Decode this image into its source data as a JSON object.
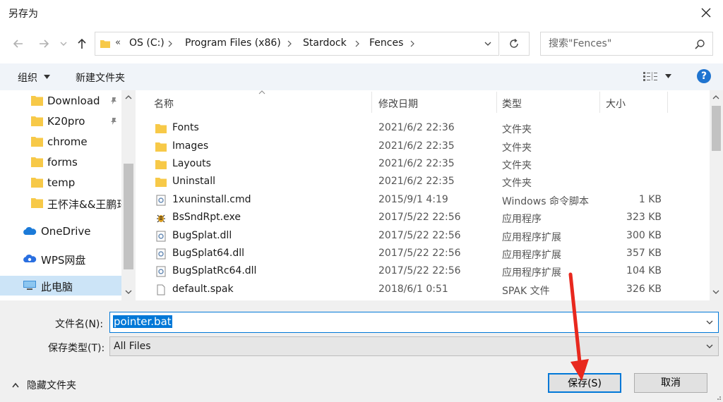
{
  "window": {
    "title": "另存为"
  },
  "address": {
    "crumbs": [
      "OS (C:)",
      "Program Files (x86)",
      "Stardock",
      "Fences"
    ],
    "overflow": "«"
  },
  "search": {
    "placeholder": "搜索\"Fences\""
  },
  "toolbar": {
    "organize": "组织",
    "new_folder": "新建文件夹",
    "help": "?"
  },
  "sidebar": {
    "items": [
      {
        "label": "Download",
        "icon": "folder-icon",
        "pinned": true
      },
      {
        "label": "K20pro",
        "icon": "folder-icon",
        "pinned": true
      },
      {
        "label": "chrome",
        "icon": "folder-icon",
        "pinned": false
      },
      {
        "label": "forms",
        "icon": "folder-icon",
        "pinned": false
      },
      {
        "label": "temp",
        "icon": "folder-icon",
        "pinned": false
      },
      {
        "label": "王怀沣&&王鹏玮",
        "icon": "folder-icon",
        "pinned": false
      },
      {
        "label": "OneDrive",
        "icon": "onedrive-icon",
        "pinned": false
      },
      {
        "label": "WPS网盘",
        "icon": "wps-cloud-icon",
        "pinned": false
      },
      {
        "label": "此电脑",
        "icon": "this-pc-icon",
        "pinned": false,
        "selected": true
      }
    ]
  },
  "columns": {
    "name": "名称",
    "date": "修改日期",
    "type": "类型",
    "size": "大小"
  },
  "files": [
    {
      "name": "Fonts",
      "date": "2021/6/2 22:36",
      "type": "文件夹",
      "size": "",
      "icon": "folder-icon"
    },
    {
      "name": "Images",
      "date": "2021/6/2 22:35",
      "type": "文件夹",
      "size": "",
      "icon": "folder-icon"
    },
    {
      "name": "Layouts",
      "date": "2021/6/2 22:35",
      "type": "文件夹",
      "size": "",
      "icon": "folder-icon"
    },
    {
      "name": "Uninstall",
      "date": "2021/6/2 22:35",
      "type": "文件夹",
      "size": "",
      "icon": "folder-icon"
    },
    {
      "name": "1xuninstall.cmd",
      "date": "2015/9/1 4:19",
      "type": "Windows 命令脚本",
      "size": "1 KB",
      "icon": "cmd-file-icon"
    },
    {
      "name": "BsSndRpt.exe",
      "date": "2017/5/22 22:56",
      "type": "应用程序",
      "size": "323 KB",
      "icon": "bug-exe-icon"
    },
    {
      "name": "BugSplat.dll",
      "date": "2017/5/22 22:56",
      "type": "应用程序扩展",
      "size": "300 KB",
      "icon": "dll-file-icon"
    },
    {
      "name": "BugSplat64.dll",
      "date": "2017/5/22 22:56",
      "type": "应用程序扩展",
      "size": "357 KB",
      "icon": "dll-file-icon"
    },
    {
      "name": "BugSplatRc64.dll",
      "date": "2017/5/22 22:56",
      "type": "应用程序扩展",
      "size": "104 KB",
      "icon": "dll-file-icon"
    },
    {
      "name": "default.spak",
      "date": "2018/6/1 0:51",
      "type": "SPAK 文件",
      "size": "326 KB",
      "icon": "blank-file-icon"
    }
  ],
  "bottom": {
    "filename_label": "文件名(N):",
    "filename_value": "pointer.bat",
    "filetype_label": "保存类型(T):",
    "filetype_value": "All Files",
    "hide_folders": "隐藏文件夹",
    "save": "保存(S)",
    "cancel": "取消"
  },
  "colors": {
    "accent": "#0078d7",
    "toolbar_bg": "#f0f4f9",
    "annotation": "#e8281e",
    "folder": "#f7c948"
  }
}
